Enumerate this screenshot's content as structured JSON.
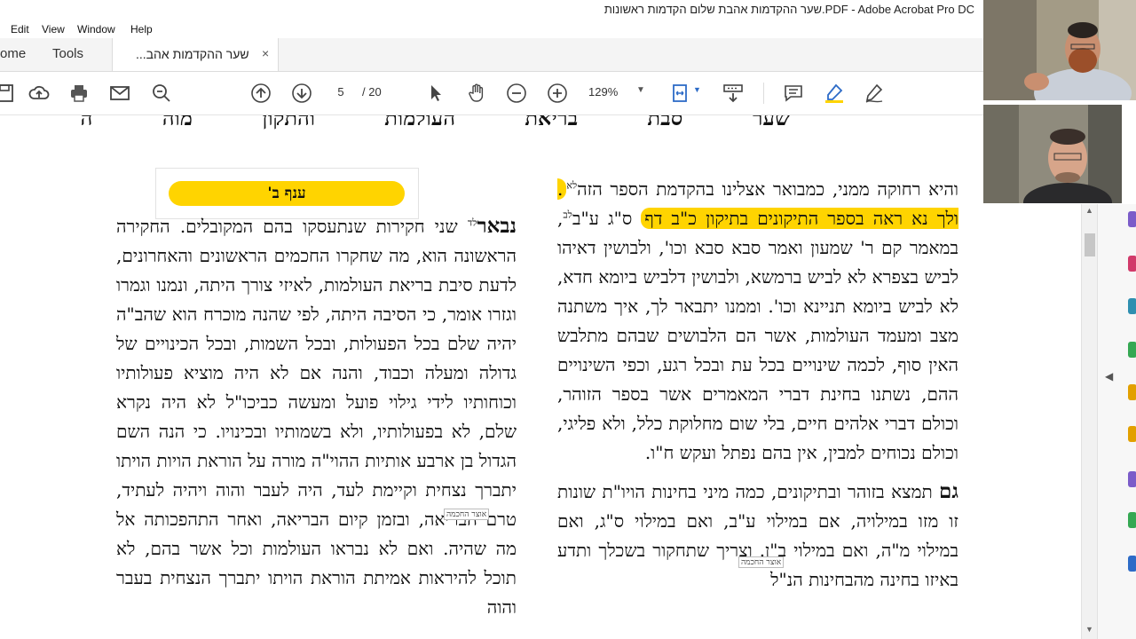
{
  "window": {
    "title": "שער ההקדמות אהבת שלום הקדמות ראשונות.PDF - Adobe Acrobat Pro DC"
  },
  "menu": [
    "Edit",
    "View",
    "Window",
    "Help"
  ],
  "tabs": {
    "home": "ome",
    "tools": "Tools",
    "document": "שער ההקדמות אהב...",
    "close": "×"
  },
  "toolbar": {
    "page_current": "5",
    "page_total": "/ 20",
    "zoom": "129%"
  },
  "icons": [
    "save-icon",
    "upload-icon",
    "print-icon",
    "email-icon",
    "zoom-search-icon",
    "page-up-icon",
    "page-down-icon",
    "select-cursor-icon",
    "hand-icon",
    "zoom-out-icon",
    "zoom-in-icon",
    "fit-page-icon",
    "scroll-mode-icon",
    "comment-icon",
    "highlighter-icon",
    "sign-icon"
  ],
  "document": {
    "running_head": "שער סבת בריאת העולמות והתקון מוה ה",
    "section_heading": "ענף ב'",
    "right_col": {
      "p1_start": "והיא רחוקה ממני, כמבואר אצלינו בהקדמת הספר הזה",
      "p1_sup1": "לא",
      "p1_highlight": ". ולך נא ראה בספר התיקונים בתיקון כ\"ב דף",
      "p1_mid": "ס\"ג ע\"ב",
      "p1_sup2": "לב",
      "p1_rest": ", במאמר קם ר' שמעון ואמר סבא סבא וכו', ולבושין דאיהו לביש בצפרא לא לביש ברמשא, ולבושין דלביש ביומא חדא, לא לביש ביומא תניינא וכו'. וממנו יתבאר לך, איך משתנה מצב ומעמד העולמות, אשר הם הלבושים שבהם מתלבש האין סוף, לכמה שינויים בכל עת ובכל רגע, וכפי השינויים ההם, נשתנו בחינת דברי המאמרים אשר בספר הזוהר, וכולם דברי אלהים חיים, בלי שום מחלוקת כלל, ולא פליגי, וכולם נכוחים למבין, אין בהם נפתל ועקש ח\"ו.",
      "p2_lead": "גם",
      "p2_text": " תמצא בזוהר ובתיקונים, כמה מיני בחינות הויו\"ת שונות זו מזו במילויה, אם במילוי ע\"ב, ואם במילוי ס\"ג, ואם במילוי מ\"ה, ואם במילוי ב\"ן. וצריך שתחקור בשכלך ותדע באיזו בחינה מהבחינות הנ\"ל"
    },
    "left_col": {
      "lead": "נבאר",
      "sup": "לד",
      "text": " שני חקירות שנתעסקו בהם המקובלים. החקירה הראשונה הוא, מה שחקרו החכמים הראשונים והאחרונים, לדעת סיבת בריאת העולמות, לאיזי צורך היתה, ונמנו וגמרו וגזרו אומר, כי הסיבה היתה, לפי שהנה מוכרח הוא שהב\"ה יהיה שלם בכל הפעולות, ובכל השמות, ובכל הכינויים של גדולה ומעלה וכבוד, והנה אם לא היה מוציא פעולותיו וכוחותיו לידי גילוי פועל ומעשה כביכו\"ל לא היה נקרא שלם, לא בפעולותיו, ולא בשמותיו ובכינויו. כי הנה השם הגדול בן ארבע אותיות ההוי\"ה מורה על הוראת הויות הויתו יתברך נצחית וקיימת לעד, היה לעבר והוה ויהיה לעתיד, טרם הבריאה, ובזמן קיום הבריאה, ואחר התהפכותה אל מה שהיה. ואם לא נבראו העולמות וכל אשר בהם, לא תוכל להיראות אמיתת הוראת הויתו יתברך הנצחית בעבר והוה"
    },
    "stamp_left": "אוצר החכמה",
    "stamp_right": "אוצר החכמה"
  },
  "colors": {
    "highlight": "#ffd400",
    "accent_blue": "#2d6bc7"
  }
}
